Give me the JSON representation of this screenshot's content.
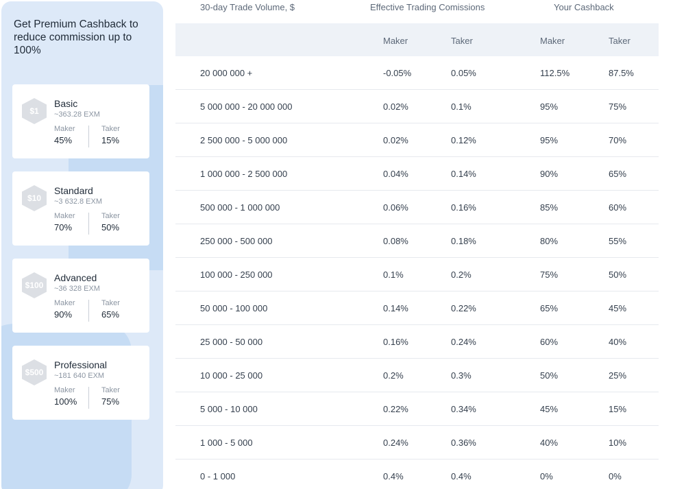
{
  "panel": {
    "title": "Get Premium Cashback to reduce commission up to 100%",
    "cards": [
      {
        "badge": "$1",
        "name": "Basic",
        "exm": "~363.28 EXM",
        "maker_label": "Maker",
        "maker": "45%",
        "taker_label": "Taker",
        "taker": "15%"
      },
      {
        "badge": "$10",
        "name": "Standard",
        "exm": "~3 632.8 EXM",
        "maker_label": "Maker",
        "maker": "70%",
        "taker_label": "Taker",
        "taker": "50%"
      },
      {
        "badge": "$100",
        "name": "Advanced",
        "exm": "~36 328 EXM",
        "maker_label": "Maker",
        "maker": "90%",
        "taker_label": "Taker",
        "taker": "65%"
      },
      {
        "badge": "$500",
        "name": "Professional",
        "exm": "~181 640 EXM",
        "maker_label": "Maker",
        "maker": "100%",
        "taker_label": "Taker",
        "taker": "75%"
      }
    ]
  },
  "table": {
    "headers": {
      "volume": "30-day Trade Volume, $",
      "commissions": "Effective Trading Comissions",
      "cashback": "Your Cashback"
    },
    "subheaders": {
      "maker1": "Maker",
      "taker1": "Taker",
      "maker2": "Maker",
      "taker2": "Taker"
    },
    "rows": [
      [
        "20 000 000 +",
        "-0.05%",
        "0.05%",
        "112.5%",
        "87.5%"
      ],
      [
        "5 000 000 - 20 000 000",
        "0.02%",
        "0.1%",
        "95%",
        "75%"
      ],
      [
        "2 500 000 - 5 000 000",
        "0.02%",
        "0.12%",
        "95%",
        "70%"
      ],
      [
        "1 000 000 - 2 500 000",
        "0.04%",
        "0.14%",
        "90%",
        "65%"
      ],
      [
        "500 000 - 1 000 000",
        "0.06%",
        "0.16%",
        "85%",
        "60%"
      ],
      [
        "250 000 - 500 000",
        "0.08%",
        "0.18%",
        "80%",
        "55%"
      ],
      [
        "100 000 - 250 000",
        "0.1%",
        "0.2%",
        "75%",
        "50%"
      ],
      [
        "50 000 - 100 000",
        "0.14%",
        "0.22%",
        "65%",
        "45%"
      ],
      [
        "25 000 - 50 000",
        "0.16%",
        "0.24%",
        "60%",
        "40%"
      ],
      [
        "10 000 - 25 000",
        "0.2%",
        "0.3%",
        "50%",
        "25%"
      ],
      [
        "5 000 - 10 000",
        "0.22%",
        "0.34%",
        "45%",
        "15%"
      ],
      [
        "1 000 - 5 000",
        "0.24%",
        "0.36%",
        "40%",
        "10%"
      ],
      [
        "0 - 1 000",
        "0.4%",
        "0.4%",
        "0%",
        "0%"
      ]
    ]
  }
}
